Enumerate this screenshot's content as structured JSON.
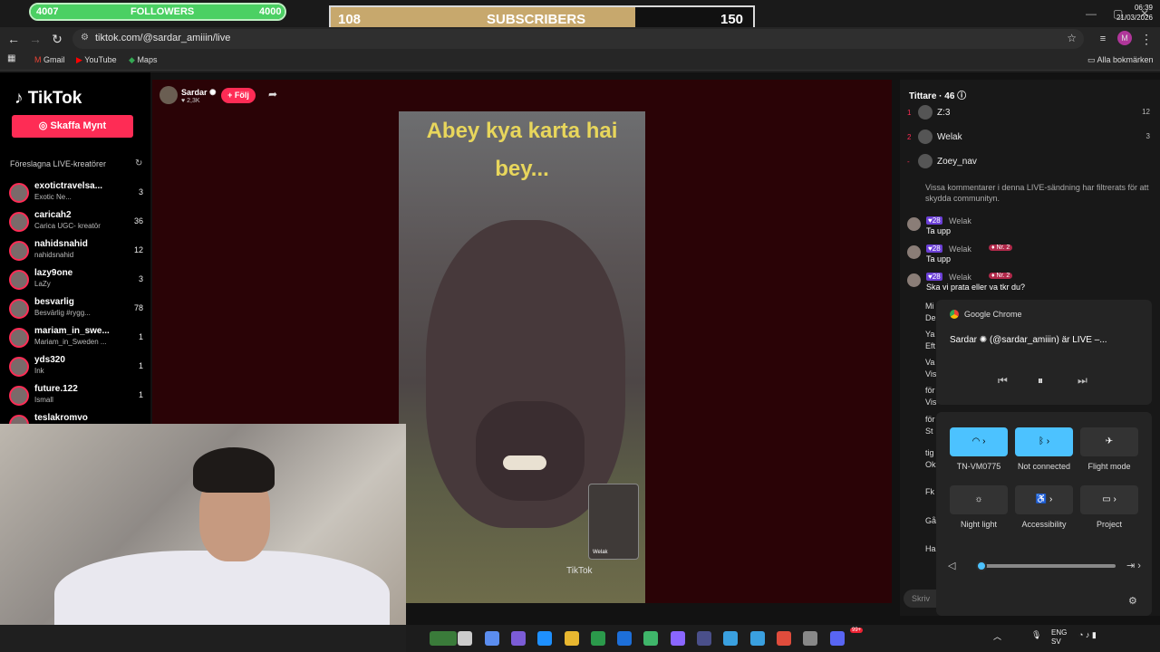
{
  "overlays": {
    "followers": {
      "current": "4007",
      "label": "FOLLOWERS",
      "goal": "4000",
      "progress": 1.0
    },
    "subscribers": {
      "current": "108",
      "label": "SUBSCRIBERS",
      "goal": "150",
      "progress": 0.72
    }
  },
  "browser": {
    "url": "tiktok.com/@sardar_amiiin/live",
    "profile_initial": "M",
    "bookmarks": [
      "Gmail",
      "YouTube",
      "Maps"
    ],
    "all_bookmarks": "Alla bokmärken"
  },
  "tiktok": {
    "logo": "TikTok",
    "coins_button": "Skaffa Mynt",
    "suggested_title": "Föreslagna LIVE-kreatörer",
    "creators": [
      {
        "name": "exotictravelsa...",
        "sub": "Exotic Ne...",
        "count": "3"
      },
      {
        "name": "caricah2",
        "sub": "Carica UGC- kreatör",
        "count": "36"
      },
      {
        "name": "nahidsnahid",
        "sub": "nahidsnahid",
        "count": "12"
      },
      {
        "name": "lazy9one",
        "sub": "LaZy",
        "count": "3"
      },
      {
        "name": "besvarlig",
        "sub": "Besvärlig #rygg...",
        "count": "78"
      },
      {
        "name": "mariam_in_swe...",
        "sub": "Mariam_in_Sweden ...",
        "count": "1"
      },
      {
        "name": "yds320",
        "sub": "Ink",
        "count": "1"
      },
      {
        "name": "future.122",
        "sub": "Ismall",
        "count": "1"
      },
      {
        "name": "teslakromvo",
        "sub": "",
        "count": ""
      }
    ],
    "host": {
      "name": "Sardar",
      "likes": "2,3K",
      "follow": "+ Följ"
    },
    "video": {
      "caption1": "Abey kya karta hai",
      "caption2": "bey...",
      "watermark": "TikTok",
      "pip_name": "Welak"
    },
    "viewers": {
      "title": "Tittare · 46",
      "list": [
        {
          "rank": "1",
          "name": "Z:3",
          "score": "12"
        },
        {
          "rank": "2",
          "name": "Welak",
          "score": "3"
        },
        {
          "rank": "-",
          "name": "Zoey_nav",
          "score": ""
        }
      ]
    },
    "system_message": "Vissa kommentarer i denna LIVE-sändning har filtrerats för att skydda communityn.",
    "comments": [
      {
        "badge": "28",
        "name": "Welak",
        "nr": "",
        "text": "Ta upp"
      },
      {
        "badge": "28",
        "name": "Welak",
        "nr": "Nr. 2",
        "text": "Ta upp"
      },
      {
        "badge": "28",
        "name": "Welak",
        "nr": "Nr. 2",
        "text": "Ska vi prata eller va tkr du?"
      }
    ],
    "partial_lines": [
      "Mi",
      "De",
      "Ya",
      "Eft",
      "Va",
      "Vis",
      "för",
      "Vis",
      "för",
      "St",
      "tig",
      "Ok",
      "Fk",
      "Gå",
      "Ha"
    ],
    "write_placeholder": "Skriv"
  },
  "media_popup": {
    "app": "Google Chrome",
    "title": "Sardar ✺ (@sardar_amiiin) är LIVE –..."
  },
  "quick_settings": {
    "tiles": [
      {
        "label": "TN-VM0775",
        "icon": "wifi-icon",
        "on": true
      },
      {
        "label": "Not connected",
        "icon": "bluetooth-icon",
        "on": true
      },
      {
        "label": "Flight mode",
        "icon": "airplane-icon",
        "on": false
      },
      {
        "label": "Night light",
        "icon": "sun-icon",
        "on": false
      },
      {
        "label": "Accessibility",
        "icon": "accessibility-icon",
        "on": false
      },
      {
        "label": "Project",
        "icon": "project-icon",
        "on": false
      }
    ],
    "volume": 0.0
  },
  "taskbar": {
    "lang": "ENG",
    "region": "SV",
    "time": "06:39",
    "date": "21/03/2026",
    "badge": "99+"
  }
}
